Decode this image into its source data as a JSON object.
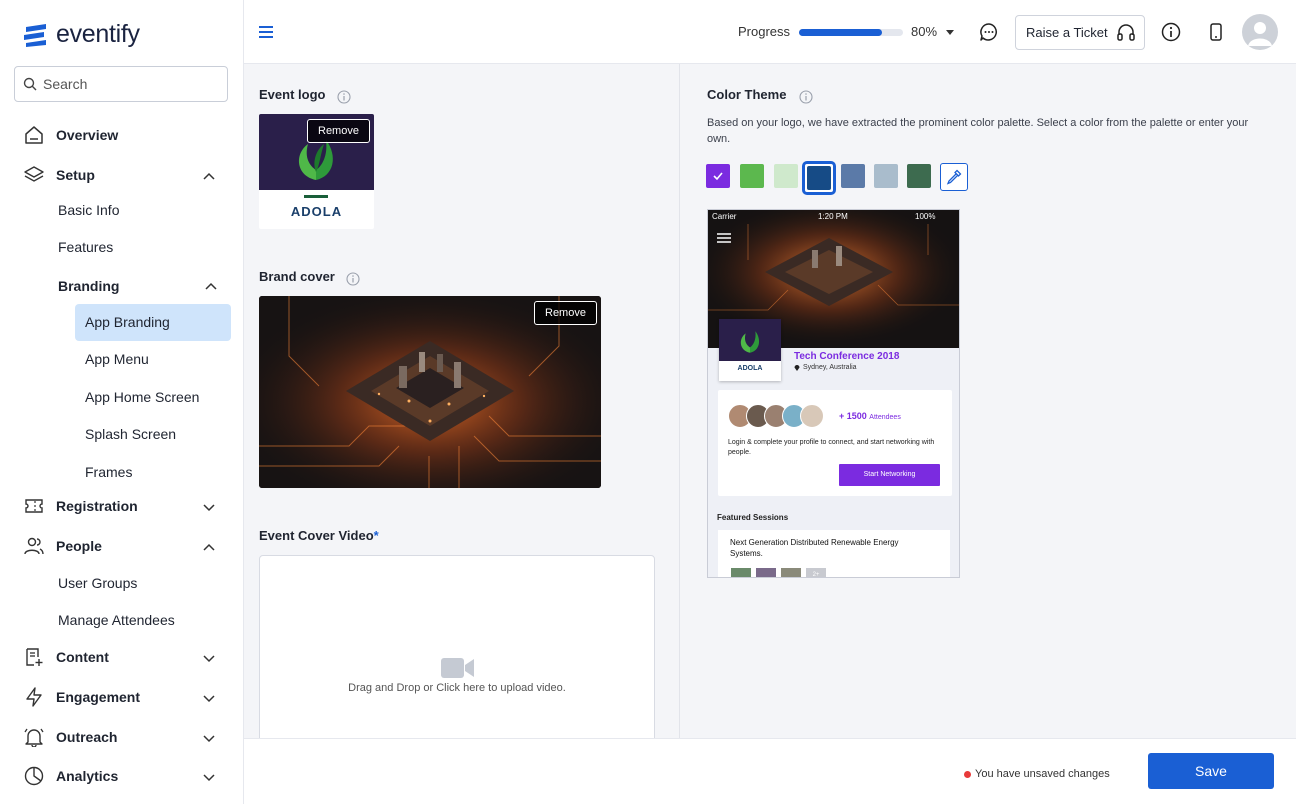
{
  "app": {
    "name": "eventify"
  },
  "search": {
    "placeholder": "Search"
  },
  "sidebar": {
    "overview": "Overview",
    "setup": "Setup",
    "setup_items": {
      "basic_info": "Basic Info",
      "features": "Features",
      "branding": "Branding"
    },
    "branding_items": {
      "app_branding": "App Branding",
      "app_menu": "App Menu",
      "app_home_screen": "App Home Screen",
      "splash_screen": "Splash Screen",
      "frames": "Frames"
    },
    "registration": "Registration",
    "people": "People",
    "people_items": {
      "user_groups": "User Groups",
      "manage_attendees": "Manage Attendees"
    },
    "content": "Content",
    "engagement": "Engagement",
    "outreach": "Outreach",
    "analytics": "Analytics"
  },
  "header": {
    "progress_label": "Progress",
    "progress_value": 80,
    "progress_text": "80%",
    "ticket_label": "Raise a Ticket"
  },
  "left": {
    "event_logo_title": "Event logo",
    "logo_text": "ADOLA",
    "remove_label": "Remove",
    "brand_cover_title": "Brand cover",
    "cover_video_title": "Event Cover Video",
    "required_mark": "*",
    "upload_text": "Drag and Drop or Click here to upload video."
  },
  "right": {
    "color_theme_title": "Color Theme",
    "description": "Based on your logo, we have extracted the prominent color palette. Select a color from the palette or enter your own.",
    "palette": [
      "#7b2be0",
      "#5cb84e",
      "#cfe9cc",
      "#164b86",
      "#5b7aa8",
      "#a9bccc",
      "#3d6b4f"
    ],
    "selected_color": "#164b86"
  },
  "preview": {
    "status_carrier": "Carrier",
    "status_time": "1:20 PM",
    "status_battery": "100%",
    "logo_text": "ADOLA",
    "event_title": "Tech Conference 2018",
    "location": "Sydney, Australia",
    "attendees_count": "+ 1500",
    "attendees_label": "Attendees",
    "message": "Login & complete your profile to connect, and start networking with people.",
    "cta": "Start Networking",
    "featured_title": "Featured Sessions",
    "session_title": "Next Generation Distributed Renewable Energy Systems.",
    "more_count": "2+"
  },
  "footer": {
    "unsaved_text": "You have unsaved changes",
    "save_label": "Save"
  }
}
